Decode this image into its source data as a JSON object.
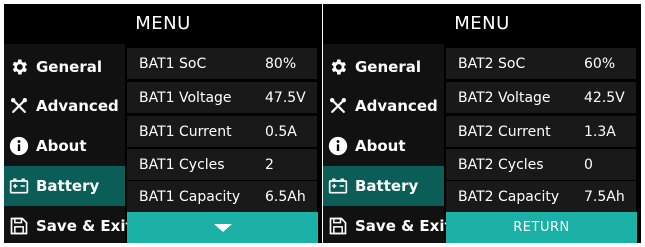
{
  "panels": [
    {
      "title": "MENU",
      "sidebar": [
        {
          "label": "General",
          "icon": "gear-icon"
        },
        {
          "label": "Advanced",
          "icon": "tools-icon"
        },
        {
          "label": "About",
          "icon": "info-icon"
        },
        {
          "label": "Battery",
          "icon": "battery-icon",
          "active": true
        },
        {
          "label": "Save & Exit",
          "icon": "save-icon"
        }
      ],
      "rows": [
        {
          "label": "BAT1 SoC",
          "value": "80%"
        },
        {
          "label": "BAT1 Voltage",
          "value": "47.5V"
        },
        {
          "label": "BAT1 Current",
          "value": "0.5A"
        },
        {
          "label": "BAT1 Cycles",
          "value": "2"
        },
        {
          "label": "BAT1 Capacity",
          "value": "6.5Ah"
        }
      ],
      "footer": {
        "icon": "arrow-down-icon"
      }
    },
    {
      "title": "MENU",
      "sidebar": [
        {
          "label": "General",
          "icon": "gear-icon"
        },
        {
          "label": "Advanced",
          "icon": "tools-icon"
        },
        {
          "label": "About",
          "icon": "info-icon"
        },
        {
          "label": "Battery",
          "icon": "battery-icon",
          "active": true
        },
        {
          "label": "Save & Exit",
          "icon": "save-icon"
        }
      ],
      "rows": [
        {
          "label": "BAT2 SoC",
          "value": "60%"
        },
        {
          "label": "BAT2 Voltage",
          "value": "42.5V"
        },
        {
          "label": "BAT2 Current",
          "value": "1.3A"
        },
        {
          "label": "BAT2 Cycles",
          "value": "0"
        },
        {
          "label": "BAT2 Capacity",
          "value": "7.5Ah"
        }
      ],
      "footer": {
        "label": "RETURN"
      }
    }
  ],
  "colors": {
    "background": "#000000",
    "active_item": "#0b5e57",
    "footer_button": "#1bb1a6",
    "row_background": "#191919",
    "text": "#ffffff"
  }
}
